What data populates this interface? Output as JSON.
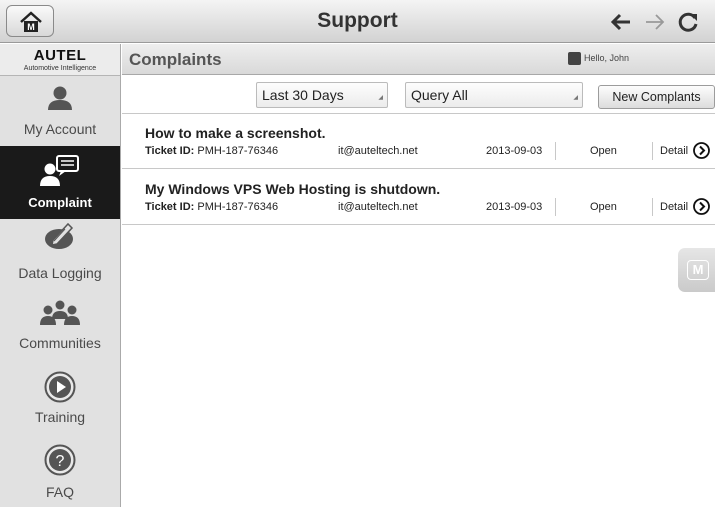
{
  "topbar": {
    "title": "Support",
    "home_icon": "home-icon",
    "back_icon": "arrow-left-icon",
    "forward_icon": "arrow-right-icon",
    "refresh_icon": "refresh-icon"
  },
  "sidebar": {
    "logo": "AUTEL",
    "logo_tagline": "Automotive Intelligence",
    "items": [
      {
        "label": "My Account",
        "icon": "person-icon"
      },
      {
        "label": "Complaint",
        "icon": "complaint-icon",
        "active": true
      },
      {
        "label": "Data Logging",
        "icon": "data-logging-icon"
      },
      {
        "label": "Communities",
        "icon": "communities-icon"
      },
      {
        "label": "Training",
        "icon": "play-icon"
      },
      {
        "label": "FAQ",
        "icon": "question-icon"
      }
    ]
  },
  "header": {
    "title": "Complaints",
    "greeting": "Hello, John"
  },
  "filters": {
    "period": "Last 30 Days",
    "query": "Query All",
    "new_button": "New Complants"
  },
  "tickets": [
    {
      "subject": "How to make a screenshot.",
      "id_label": "Ticket ID:",
      "id": "PMH-187-76346",
      "email": "it@auteltech.net",
      "date": "2013-09-03",
      "status": "Open",
      "detail": "Detail"
    },
    {
      "subject": "My Windows VPS Web Hosting is shutdown.",
      "id_label": "Ticket ID:",
      "id": "PMH-187-76346",
      "email": "it@auteltech.net",
      "date": "2013-09-03",
      "status": "Open",
      "detail": "Detail"
    }
  ],
  "floating_button": "M",
  "colors": {
    "active_nav_bg": "#1a1a1a",
    "sidebar_bg": "#e1e1e1",
    "icon_gray": "#555555"
  }
}
